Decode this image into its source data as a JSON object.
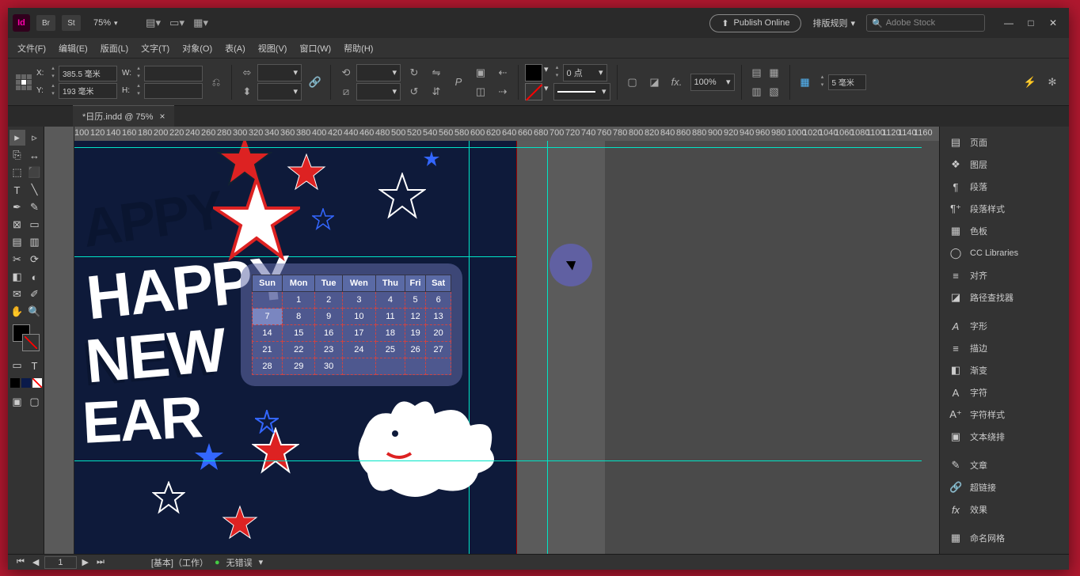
{
  "titlebar": {
    "zoom": "75%",
    "publish": "Publish Online",
    "workspace": "排版规则",
    "stock_placeholder": "Adobe Stock"
  },
  "menu": {
    "file": "文件(F)",
    "edit": "编辑(E)",
    "layout": "版面(L)",
    "type": "文字(T)",
    "object": "对象(O)",
    "table": "表(A)",
    "view": "视图(V)",
    "window": "窗口(W)",
    "help": "帮助(H)"
  },
  "control": {
    "x": "385.5 毫米",
    "y": "193 毫米",
    "w": "",
    "h": "",
    "stroke_pt": "0 点",
    "scale": "100%",
    "gap": "5 毫米"
  },
  "doc": {
    "tab": "*日历.indd @ 75%"
  },
  "ruler_marks": [
    "100",
    "120",
    "140",
    "160",
    "180",
    "200",
    "220",
    "240",
    "260",
    "280",
    "300",
    "320",
    "340",
    "360",
    "380",
    "400",
    "420",
    "440",
    "460",
    "480",
    "500",
    "520",
    "540",
    "560",
    "580",
    "600",
    "620",
    "640",
    "660",
    "680",
    "700",
    "720",
    "740",
    "760",
    "780",
    "800",
    "820",
    "840",
    "860",
    "880",
    "900",
    "920",
    "940",
    "960",
    "980",
    "1000",
    "1020",
    "1040",
    "1060",
    "1080",
    "1100",
    "1120",
    "1140",
    "1160"
  ],
  "calendar": {
    "head": [
      "Sun",
      "Mon",
      "Tue",
      "Wen",
      "Thu",
      "Fri",
      "Sat"
    ],
    "rows": [
      [
        "",
        "1",
        "2",
        "3",
        "4",
        "5",
        "6"
      ],
      [
        "7",
        "8",
        "9",
        "10",
        "11",
        "12",
        "13"
      ],
      [
        "14",
        "15",
        "16",
        "17",
        "18",
        "19",
        "20"
      ],
      [
        "21",
        "22",
        "23",
        "24",
        "25",
        "26",
        "27"
      ],
      [
        "28",
        "29",
        "30",
        "",
        "",
        "",
        ""
      ]
    ]
  },
  "art": {
    "l1": "APPY",
    "l2": "HAPPY",
    "l3": "NEW",
    "l4": "EAR"
  },
  "panels": {
    "pages": "页面",
    "layers": "图层",
    "paragraph": "段落",
    "para_styles": "段落样式",
    "swatches": "色板",
    "cc": "CC Libraries",
    "align": "对齐",
    "pathfinder": "路径查找器",
    "glyphs": "字形",
    "stroke": "描边",
    "gradient": "渐变",
    "character": "字符",
    "char_styles": "字符样式",
    "text_wrap": "文本绕排",
    "story": "文章",
    "hyperlinks": "超链接",
    "effects": "效果",
    "named_grids": "命名网格"
  },
  "status": {
    "page": "1",
    "preflight_label": "[基本]（工作）",
    "preflight": "无错误"
  }
}
